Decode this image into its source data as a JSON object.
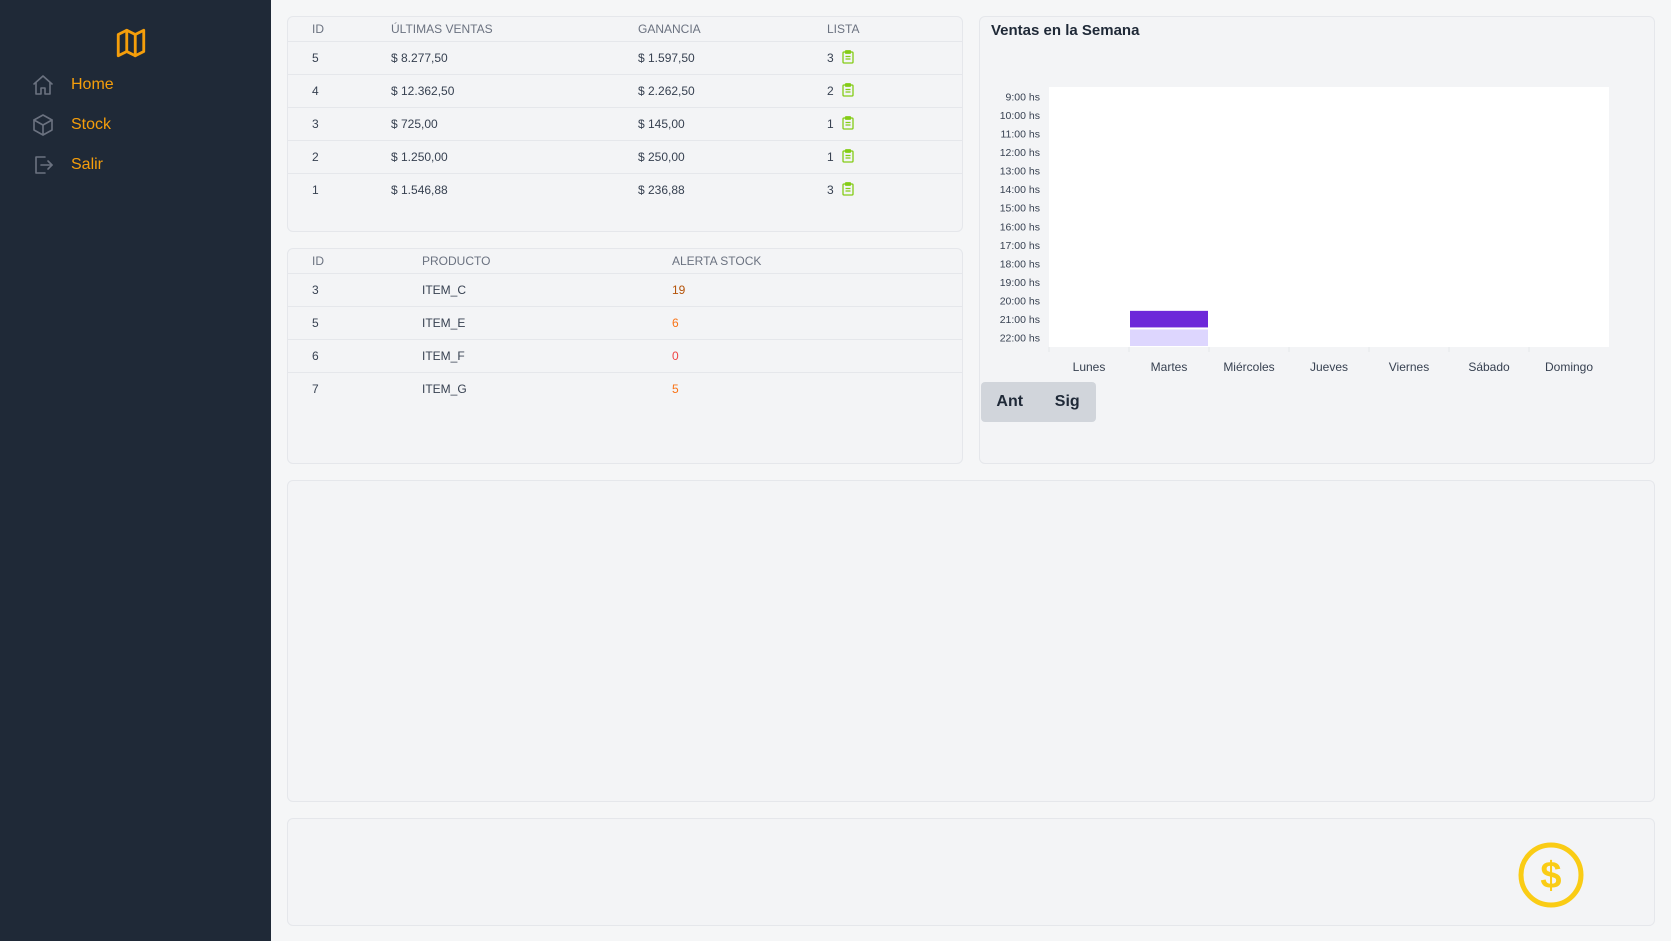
{
  "sidebar": {
    "items": [
      {
        "label": "Home",
        "icon": "home-icon"
      },
      {
        "label": "Stock",
        "icon": "box-icon"
      },
      {
        "label": "Salir",
        "icon": "logout-icon"
      }
    ]
  },
  "sales_table": {
    "headers": [
      "ID",
      "ÚLTIMAS VENTAS",
      "GANANCIA",
      "LISTA"
    ],
    "rows": [
      {
        "id": "5",
        "venta": "$ 8.277,50",
        "ganancia": "$ 1.597,50",
        "lista": "3"
      },
      {
        "id": "4",
        "venta": "$ 12.362,50",
        "ganancia": "$ 2.262,50",
        "lista": "2"
      },
      {
        "id": "3",
        "venta": "$ 725,00",
        "ganancia": "$ 145,00",
        "lista": "1"
      },
      {
        "id": "2",
        "venta": "$ 1.250,00",
        "ganancia": "$ 250,00",
        "lista": "1"
      },
      {
        "id": "1",
        "venta": "$ 1.546,88",
        "ganancia": "$ 236,88",
        "lista": "3"
      }
    ]
  },
  "stock_table": {
    "headers": [
      "ID",
      "PRODUCTO",
      "ALERTA STOCK"
    ],
    "rows": [
      {
        "id": "3",
        "producto": "ITEM_C",
        "alerta": "19"
      },
      {
        "id": "5",
        "producto": "ITEM_E",
        "alerta": "6"
      },
      {
        "id": "6",
        "producto": "ITEM_F",
        "alerta": "0"
      },
      {
        "id": "7",
        "producto": "ITEM_G",
        "alerta": "5"
      }
    ]
  },
  "chart": {
    "buttons": {
      "prev": "Ant",
      "next": "Sig"
    }
  },
  "colors": {
    "sidebar_bg": "#1f2937",
    "accent": "#f59e0b",
    "bar_strong": "#6d28d9",
    "bar_light": "#ddd6fe",
    "dollar": "#facc15"
  },
  "chart_data": {
    "type": "heatmap",
    "title": "Ventas en la Semana",
    "x": [
      "Lunes",
      "Martes",
      "Miércoles",
      "Jueves",
      "Viernes",
      "Sábado",
      "Domingo"
    ],
    "y": [
      "9:00 hs",
      "10:00 hs",
      "11:00 hs",
      "12:00 hs",
      "13:00 hs",
      "14:00 hs",
      "15:00 hs",
      "16:00 hs",
      "17:00 hs",
      "18:00 hs",
      "19:00 hs",
      "20:00 hs",
      "21:00 hs",
      "22:00 hs"
    ],
    "cells": [
      {
        "day": "Martes",
        "hour": "21:00 hs",
        "level": "high"
      },
      {
        "day": "Martes",
        "hour": "22:00 hs",
        "level": "low"
      }
    ]
  }
}
